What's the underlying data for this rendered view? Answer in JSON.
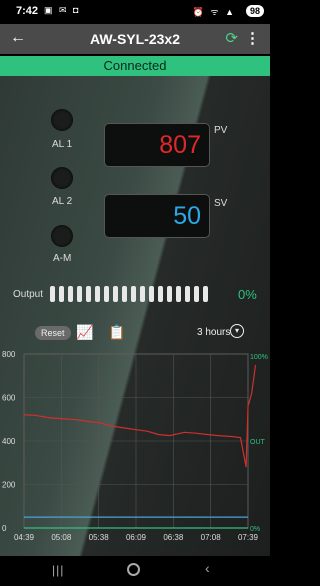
{
  "status_bar": {
    "time": "7:42",
    "left_icons": "▣ ✉ ◘",
    "right_icons": "⏰ ᯤ ▲",
    "battery": "98"
  },
  "app_bar": {
    "title": "AW-SYL-23x2"
  },
  "connection": {
    "status": "Connected"
  },
  "controller": {
    "al1_label": "AL 1",
    "al2_label": "AL 2",
    "am_label": "A-M",
    "pv_label": "PV",
    "pv_value": "807",
    "sv_label": "SV",
    "sv_value": "50",
    "output_label": "Output",
    "output_percent": "0%",
    "output_segments": 18
  },
  "toolbar": {
    "reset_label": "Reset",
    "range_label": "3 hours"
  },
  "icons": {
    "back": "arrow-left-icon",
    "refresh": "refresh-icon",
    "more": "more-vert-icon",
    "chart": "chart-icon",
    "edit": "clipboard-edit-icon",
    "range": "chevron-down-icon"
  },
  "colors": {
    "pv": "#e02828",
    "sv": "#2aa9e6",
    "accent": "#2ec27e"
  },
  "chart_data": {
    "type": "line",
    "x": [
      "04:39",
      "05:08",
      "05:38",
      "06:09",
      "06:38",
      "07:08",
      "07:39"
    ],
    "y_left_ticks": [
      "800",
      "600",
      "400",
      "200",
      "0"
    ],
    "y_right_labels": [
      "100%",
      "OUT",
      "0%"
    ],
    "ylim": [
      0,
      800
    ],
    "grid": true,
    "series": [
      {
        "color": "#d0302a",
        "x": [
          0,
          0.3,
          0.7,
          1,
          1.4,
          1.8,
          2,
          2.3,
          2.7,
          3,
          3.3,
          3.6,
          3.9,
          4.3,
          4.6,
          4.9,
          5.2,
          5.6,
          5.8,
          5.95,
          6.0,
          6.1,
          6.2
        ],
        "values": [
          520,
          518,
          506,
          503,
          498,
          488,
          485,
          470,
          460,
          452,
          445,
          430,
          425,
          440,
          436,
          430,
          425,
          420,
          415,
          280,
          560,
          620,
          750
        ]
      },
      {
        "color": "#4aa3d8",
        "x": [
          0,
          6.0
        ],
        "values": [
          50,
          50
        ]
      },
      {
        "color": "#2ec27e",
        "x": [
          0,
          6.0
        ],
        "values": [
          0,
          0
        ]
      }
    ]
  }
}
